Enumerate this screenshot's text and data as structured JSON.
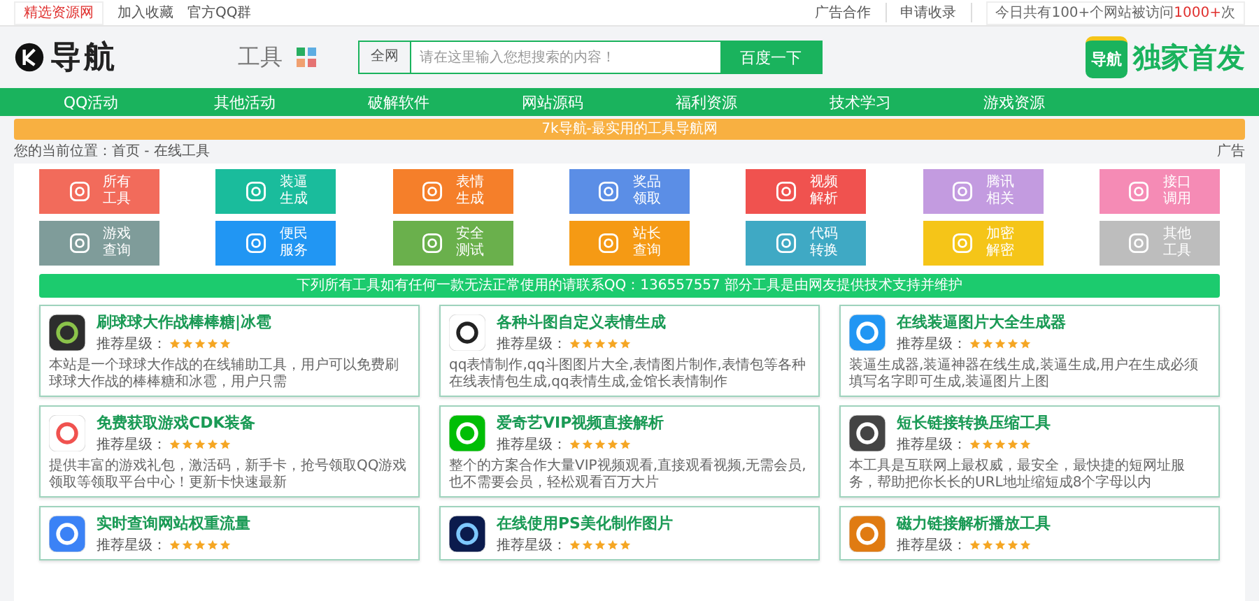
{
  "top_bar": {
    "site_link": "精选资源网",
    "links": [
      "加入收藏",
      "官方QQ群"
    ],
    "right_links": [
      "广告合作",
      "申请收录"
    ],
    "stats": [
      {
        "text": "今日共有100+个网站被访问",
        "highlight": false
      },
      {
        "text": "1000+",
        "highlight": true
      },
      {
        "text": "次",
        "highlight": false
      }
    ]
  },
  "header": {
    "logo_text": "导航",
    "section_label": "工具",
    "search": {
      "scope": "全网",
      "placeholder": "请在这里输入您想搜索的内容！",
      "button": "百度一下"
    },
    "badge_icon_text": "导航",
    "badge_text": "独家首发"
  },
  "nav": [
    "QQ活动",
    "其他活动",
    "破解软件",
    "网站源码",
    "福利资源",
    "技术学习",
    "游戏资源"
  ],
  "banner": "7k导航-最实用的工具导航网",
  "breadcrumb": "您的当前位置：首页 - 在线工具",
  "ad_label": "广告",
  "categories": [
    {
      "label": "所有工具",
      "color": "#f26b5b"
    },
    {
      "label": "装逼生成",
      "color": "#1abc9c"
    },
    {
      "label": "表情生成",
      "color": "#f57f2a"
    },
    {
      "label": "奖品领取",
      "color": "#5b8ee6"
    },
    {
      "label": "视频解析",
      "color": "#f0524f"
    },
    {
      "label": "腾讯相关",
      "color": "#c39be0"
    },
    {
      "label": "接口调用",
      "color": "#f58bb5"
    },
    {
      "label": "游戏查询",
      "color": "#7f9c9a"
    },
    {
      "label": "便民服务",
      "color": "#2196f3"
    },
    {
      "label": "安全测试",
      "color": "#6ab04c"
    },
    {
      "label": "站长查询",
      "color": "#f59a14"
    },
    {
      "label": "代码转换",
      "color": "#3fa9c4"
    },
    {
      "label": "加密解密",
      "color": "#f5c518"
    },
    {
      "label": "其他工具",
      "color": "#bdbdbd"
    }
  ],
  "notice": "下列所有工具如有任何一款无法正常使用的请联系QQ：136557557 部分工具是由网友提供技术支持并维护",
  "tools": [
    {
      "title": "刷球球大作战棒棒糖|冰雹",
      "rating_label": "推荐星级：",
      "stars": 5,
      "description": "本站是一个球球大作战的在线辅助工具，用户可以免费刷球球大作战的棒棒糖和冰雹，用户只需"
    },
    {
      "title": "各种斗图自定义表情生成",
      "rating_label": "推荐星级：",
      "stars": 5,
      "description": "qq表情制作,qq斗图图片大全,表情图片制作,表情包等各种在线表情包生成,qq表情生成,金馆长表情制作"
    },
    {
      "title": "在线装逼图片大全生成器",
      "rating_label": "推荐星级：",
      "stars": 5,
      "description": "装逼生成器,装逼神器在线生成,装逼生成,用户在生成必须填写名字即可生成,装逼图片上图"
    },
    {
      "title": "免费获取游戏CDK装备",
      "rating_label": "推荐星级：",
      "stars": 5,
      "description": "提供丰富的游戏礼包，激活码，新手卡，抢号领取QQ游戏领取等领取平台中心！更新卡快速最新"
    },
    {
      "title": "爱奇艺VIP视频直接解析",
      "rating_label": "推荐星级：",
      "stars": 5,
      "description": "整个的方案合作大量VIP视频观看,直接观看视频,无需会员,也不需要会员，轻松观看百万大片"
    },
    {
      "title": "短长链接转换压缩工具",
      "rating_label": "推荐星级：",
      "stars": 5,
      "description": "本工具是互联网上最权威，最安全，最快捷的短网址服务，帮助把你长长的URL地址缩短成8个字母以内"
    },
    {
      "title": "实时查询网站权重流量",
      "rating_label": "推荐星级：",
      "stars": 5
    },
    {
      "title": "在线使用PS美化制作图片",
      "rating_label": "推荐星级：",
      "stars": 5
    },
    {
      "title": "磁力链接解析播放工具",
      "rating_label": "推荐星级：",
      "stars": 5
    }
  ]
}
